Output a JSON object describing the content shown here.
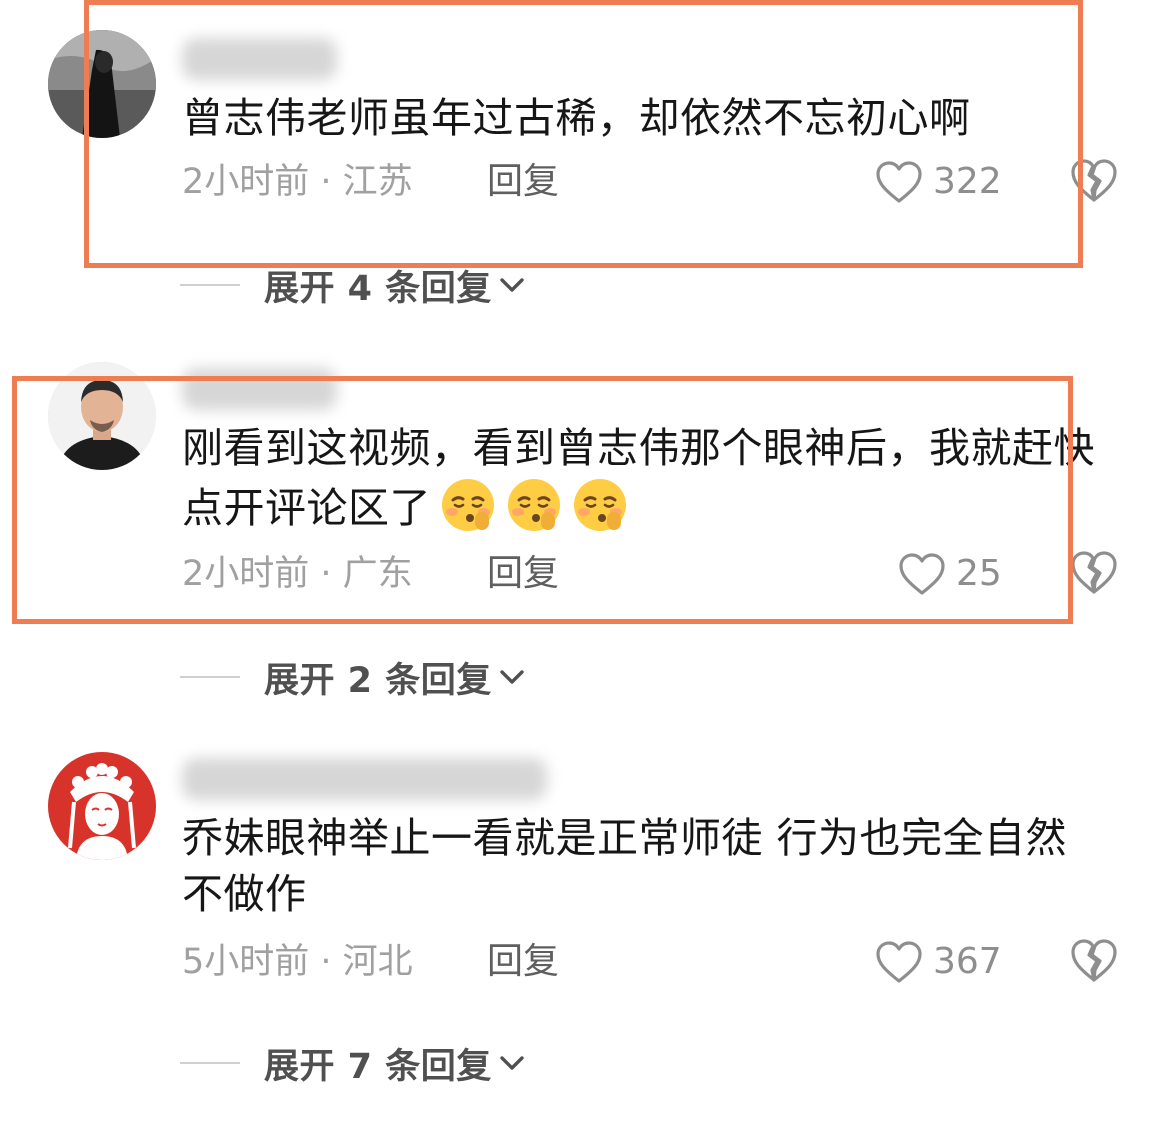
{
  "comments": [
    {
      "text": "曾志伟老师虽年过古稀，却依然不忘初心啊",
      "time": "2小时前",
      "location": "江苏",
      "reply_label": "回复",
      "likes": "322",
      "expand_label": "展开 4 条回复",
      "highlighted": true
    },
    {
      "text": "刚看到这视频，看到曾志伟那个眼神后，我就赶快点开评论区了",
      "emoji": [
        "shushing-face",
        "shushing-face",
        "shushing-face"
      ],
      "time": "2小时前",
      "location": "广东",
      "reply_label": "回复",
      "likes": "25",
      "expand_label": "展开 2 条回复",
      "highlighted": true
    },
    {
      "text": "乔妹眼神举止一看就是正常师徒 行为也完全自然不做作",
      "time": "5小时前",
      "location": "河北",
      "reply_label": "回复",
      "likes": "367",
      "expand_label": "展开 7 条回复",
      "highlighted": false
    }
  ],
  "meta_separator": " · ",
  "icons": {
    "like": "heart-outline-icon",
    "dislike": "broken-heart-icon",
    "expand": "chevron-down-icon"
  },
  "colors": {
    "highlight_border": "#ee7d53",
    "text": "#161616",
    "meta": "#a0a0a0",
    "reply": "#5f5f5f"
  }
}
